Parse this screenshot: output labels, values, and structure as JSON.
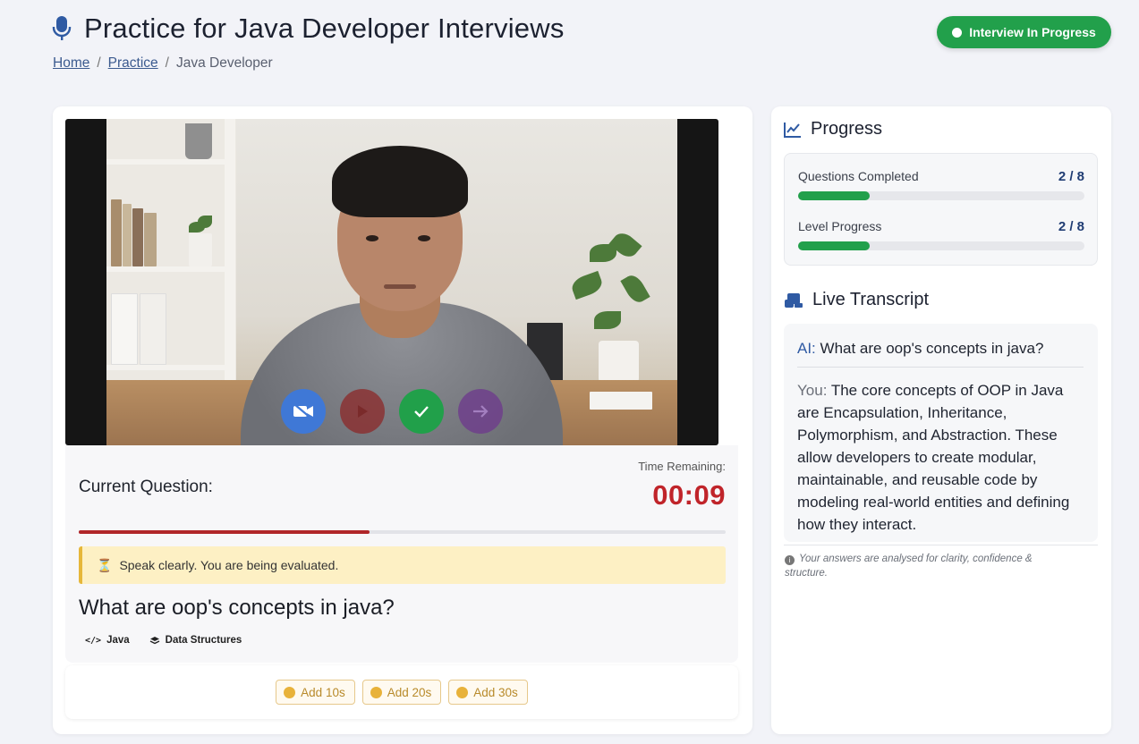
{
  "header": {
    "title": "Practice for Java Developer Interviews",
    "breadcrumb": [
      "Home",
      "Practice",
      "Java Developer"
    ],
    "breadcrumb_sep": "/",
    "status": "Interview In Progress"
  },
  "question_panel": {
    "label": "Current Question:",
    "time_label": "Time Remaining:",
    "time_value": "00:09",
    "timer_fraction": 0.45,
    "notice": "Speak clearly. You are being evaluated.",
    "question": "What are oop's concepts in java?",
    "tags": [
      "Java",
      "Data Structures"
    ]
  },
  "video_controls": [
    "camera-off-icon",
    "play-icon",
    "check-icon",
    "arrow-right-icon"
  ],
  "add_time": [
    "Add 10s",
    "Add 20s",
    "Add 30s"
  ],
  "progress": {
    "title": "Progress",
    "questions_label": "Questions Completed",
    "questions_value": "2 / 8",
    "questions_fraction": 0.25,
    "level_label": "Level Progress",
    "level_value": "2 / 8",
    "level_fraction": 0.25
  },
  "transcript": {
    "title": "Live Transcript",
    "ai_speaker": "AI:",
    "ai_text": "What are oop's concepts in java?",
    "you_speaker": "You:",
    "you_text": "The core concepts of OOP in Java are Encapsulation, Inheritance, Polymorphism, and Abstraction. These allow developers to create modular, maintainable, and reusable code by modeling real-world entities and defining how they interact.",
    "footnote": "Your answers are analysed for clarity, confidence & structure."
  },
  "colors": {
    "accent_blue": "#2f5aa3",
    "success_green": "#22a04b",
    "timer_red": "#c0242a",
    "notice_yellow": "#fdf0c4"
  }
}
